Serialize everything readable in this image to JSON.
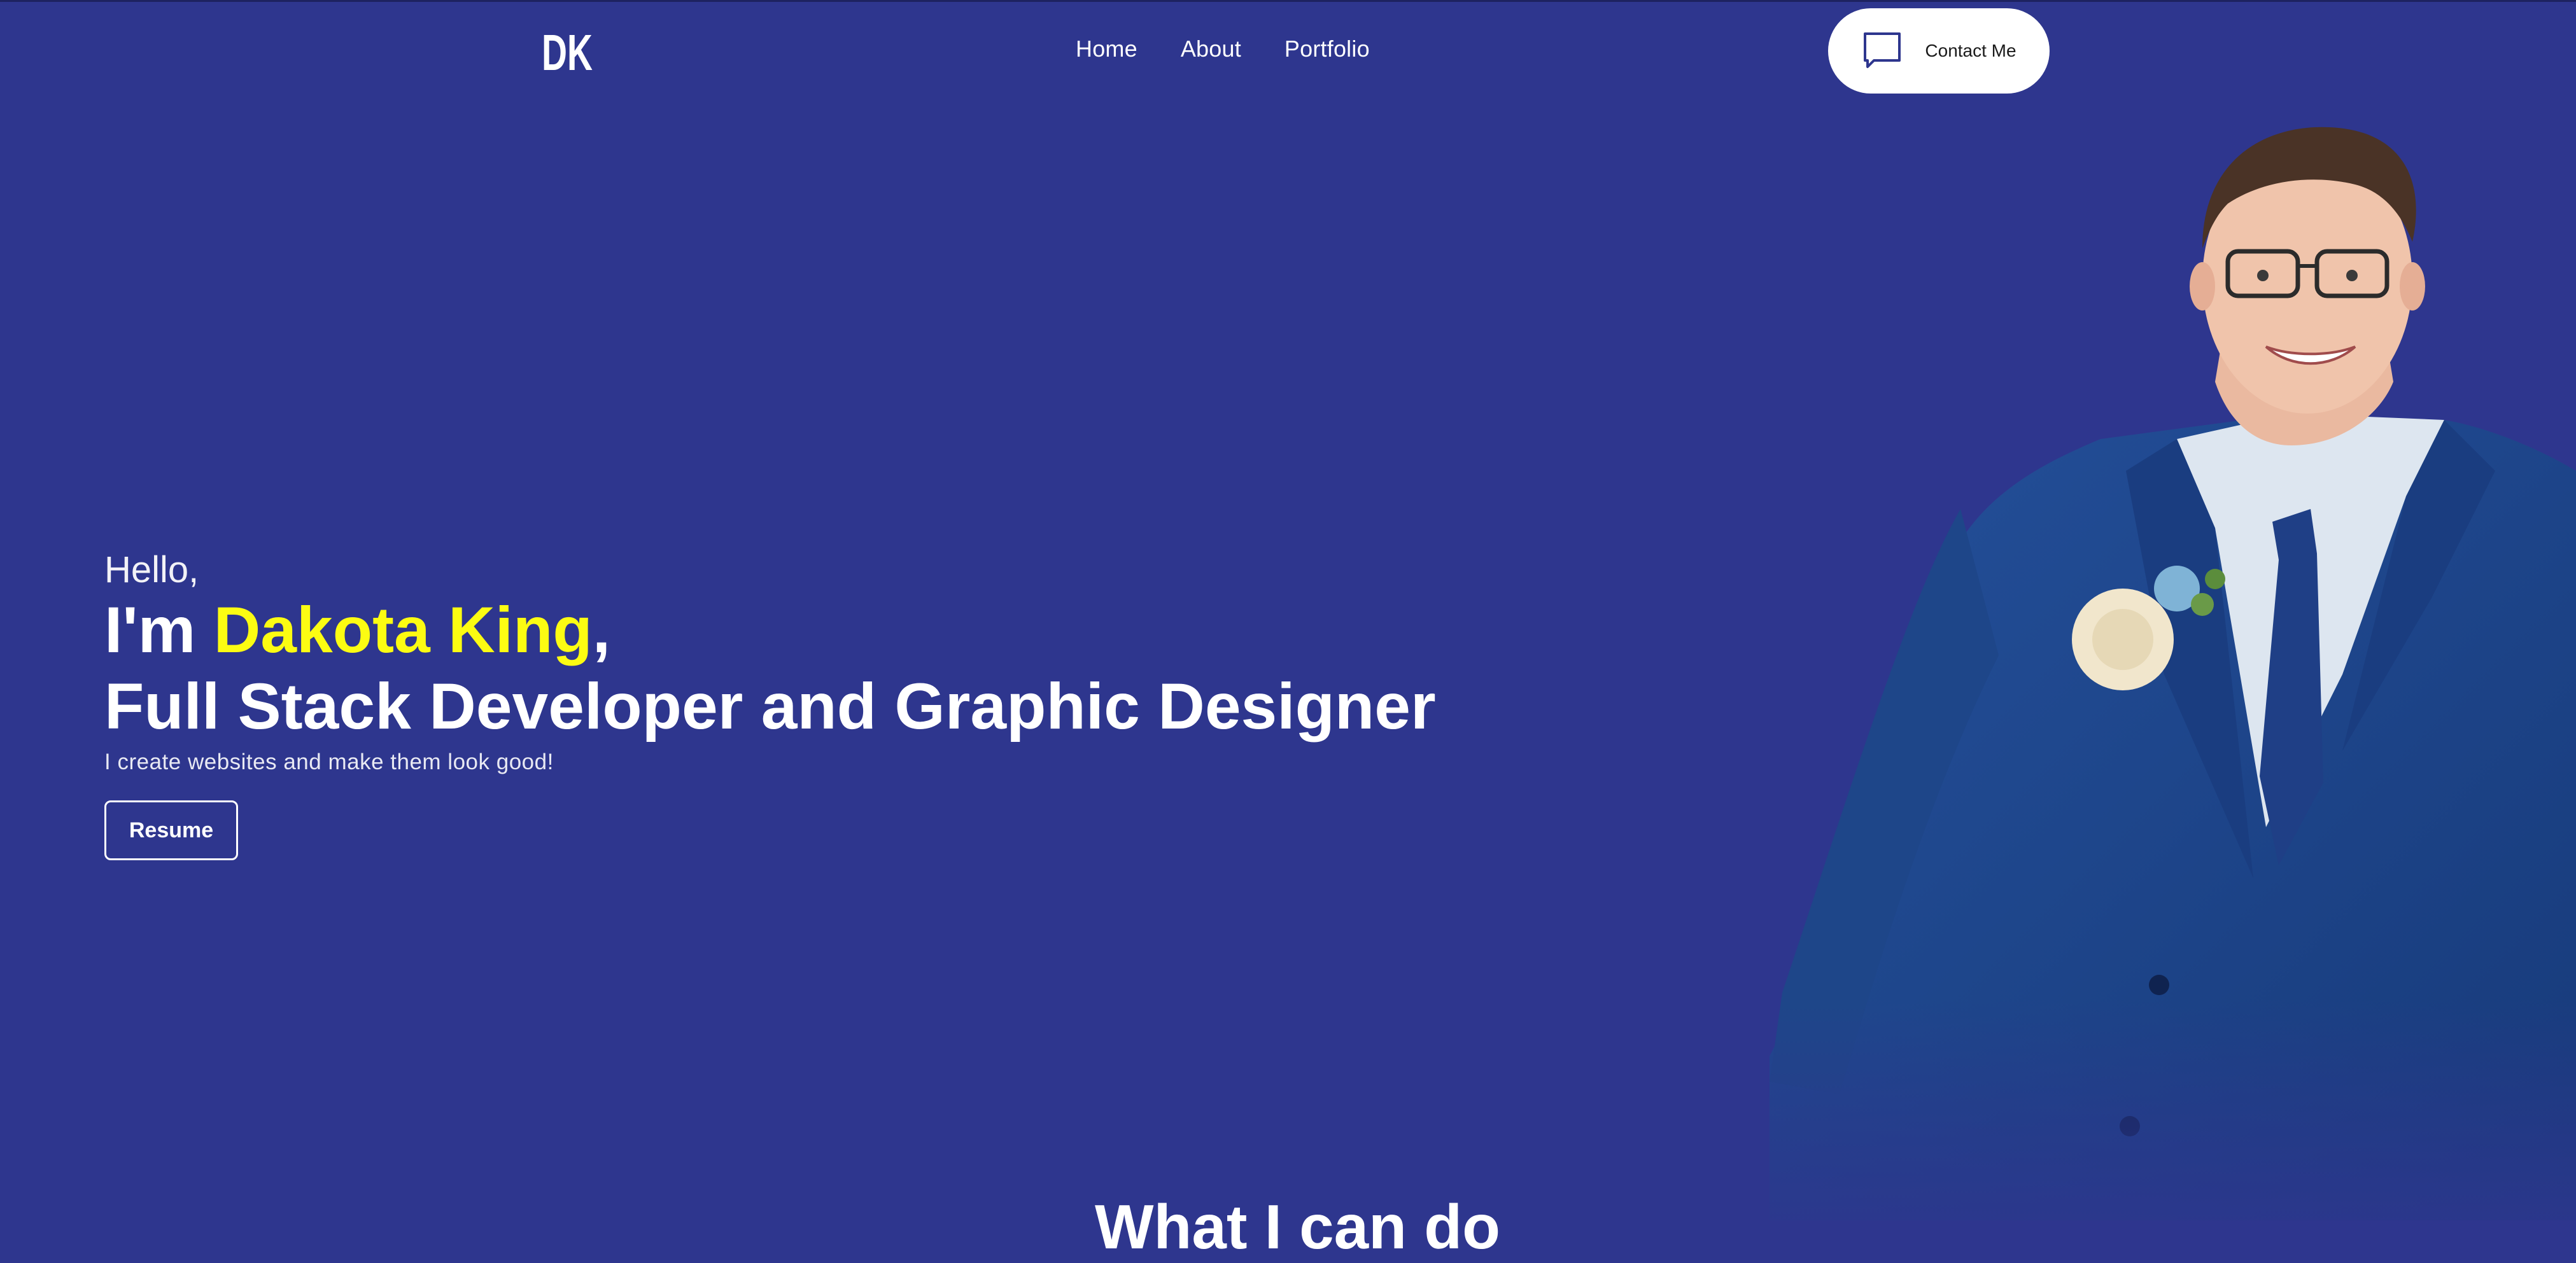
{
  "header": {
    "logo_text": "DK",
    "nav": [
      {
        "label": "Home"
      },
      {
        "label": "About"
      },
      {
        "label": "Portfolio"
      }
    ],
    "contact_label": "Contact Me",
    "contact_icon": "chat-bubble-icon"
  },
  "hero": {
    "greeting": "Hello,",
    "intro": "I'm ",
    "name": "Dakota King",
    "comma": ",",
    "title": "Full Stack Developer and Graphic Designer",
    "tagline": "I create websites and make them look good!",
    "resume_label": "Resume",
    "portrait": "portrait-photo"
  },
  "next_section": {
    "heading_partial": "What I can do"
  },
  "colors": {
    "background": "#2e368e",
    "accent": "#fcfc12",
    "text": "#ffffff"
  }
}
